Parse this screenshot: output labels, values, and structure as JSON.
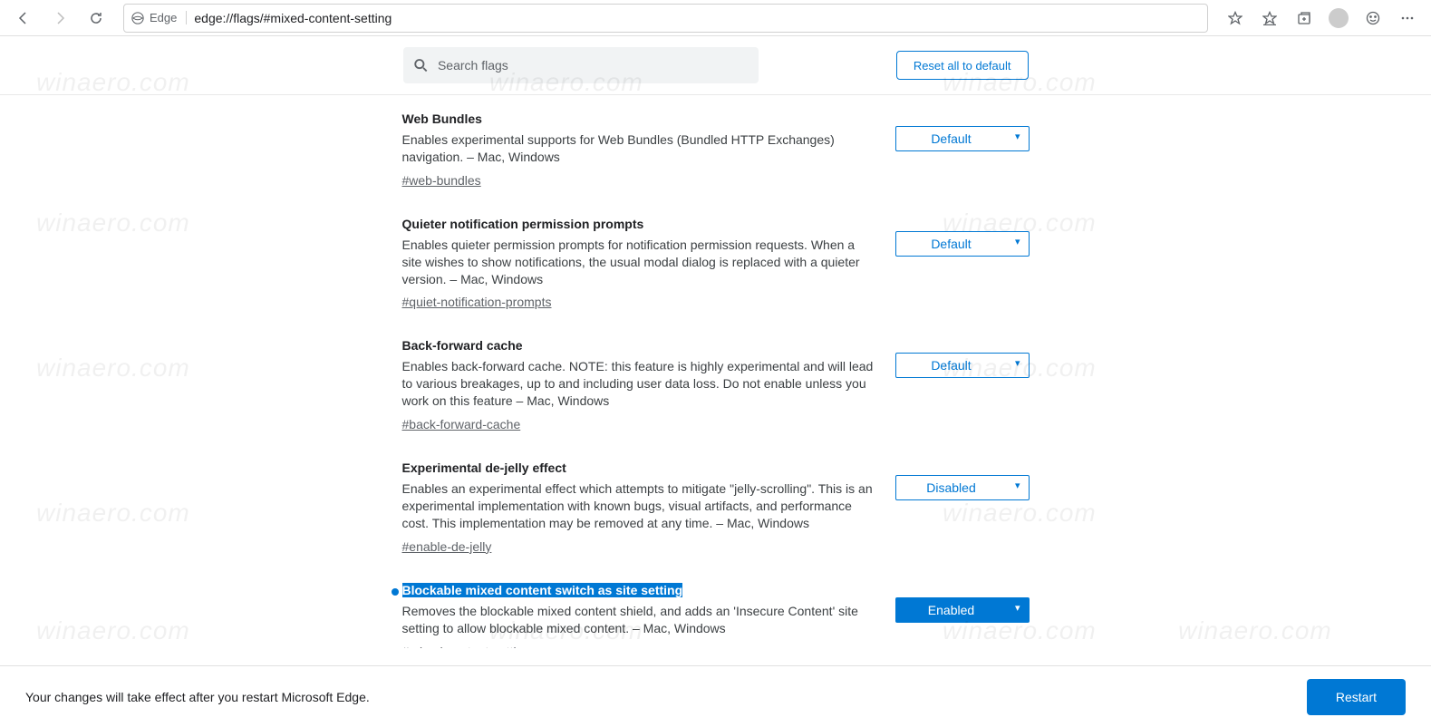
{
  "toolbar": {
    "identity": "Edge",
    "url": "edge://flags/#mixed-content-setting"
  },
  "header": {
    "search_placeholder": "Search flags",
    "reset_label": "Reset all to default"
  },
  "flags": [
    {
      "title": "Web Bundles",
      "desc": "Enables experimental supports for Web Bundles (Bundled HTTP Exchanges) navigation. – Mac, Windows",
      "anchor": "#web-bundles",
      "value": "Default",
      "highlighted": false,
      "enabled_style": false,
      "dot": false
    },
    {
      "title": "Quieter notification permission prompts",
      "desc": "Enables quieter permission prompts for notification permission requests. When a site wishes to show notifications, the usual modal dialog is replaced with a quieter version. – Mac, Windows",
      "anchor": "#quiet-notification-prompts",
      "value": "Default",
      "highlighted": false,
      "enabled_style": false,
      "dot": false
    },
    {
      "title": "Back-forward cache",
      "desc": "Enables back-forward cache. NOTE: this feature is highly experimental and will lead to various breakages, up to and including user data loss. Do not enable unless you work on this feature – Mac, Windows",
      "anchor": "#back-forward-cache",
      "value": "Default",
      "highlighted": false,
      "enabled_style": false,
      "dot": false
    },
    {
      "title": "Experimental de-jelly effect",
      "desc": "Enables an experimental effect which attempts to mitigate \"jelly-scrolling\". This is an experimental implementation with known bugs, visual artifacts, and performance cost. This implementation may be removed at any time. – Mac, Windows",
      "anchor": "#enable-de-jelly",
      "value": "Disabled",
      "highlighted": false,
      "enabled_style": false,
      "dot": false
    },
    {
      "title": "Blockable mixed content switch as site setting",
      "desc": "Removes the blockable mixed content shield, and adds an 'Insecure Content' site setting to allow blockable mixed content. – Mac, Windows",
      "anchor": "#mixed-content-setting",
      "value": "Enabled",
      "highlighted": true,
      "enabled_style": true,
      "dot": true
    }
  ],
  "footer": {
    "message": "Your changes will take effect after you restart Microsoft Edge.",
    "restart_label": "Restart"
  },
  "watermark_text": "winaero.com"
}
